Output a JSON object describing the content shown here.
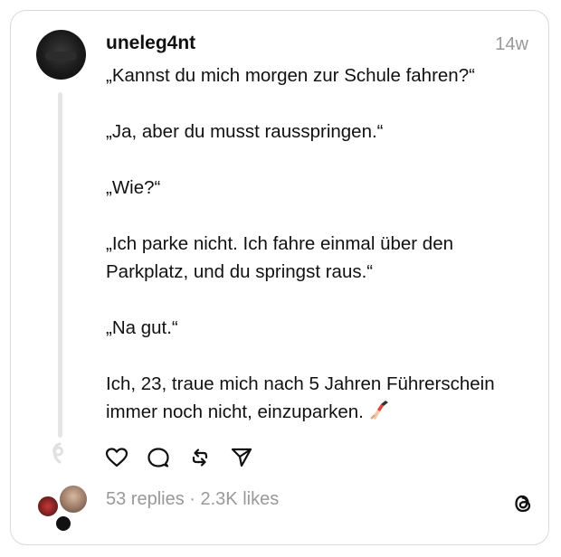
{
  "post": {
    "username": "uneleg4nt",
    "time": "14w",
    "lines": [
      "„Kannst du mich morgen zur Schule fahren?“",
      "„Ja, aber du musst rausspringen.“",
      "„Wie?“",
      "„Ich parke nicht. Ich fahre einmal über den Parkplatz, und du springst raus.“",
      "„Na gut.“",
      "Ich, 23, traue mich nach 5 Jahren Führerschein immer noch nicht, einzuparken."
    ],
    "emoji_icon": "nail-polish-icon"
  },
  "actions": {
    "icons": [
      "heart-icon",
      "comment-icon",
      "repost-icon",
      "share-icon"
    ]
  },
  "footer": {
    "stats": "53 replies · 2.3K likes",
    "logo_icon": "threads-logo-icon"
  }
}
